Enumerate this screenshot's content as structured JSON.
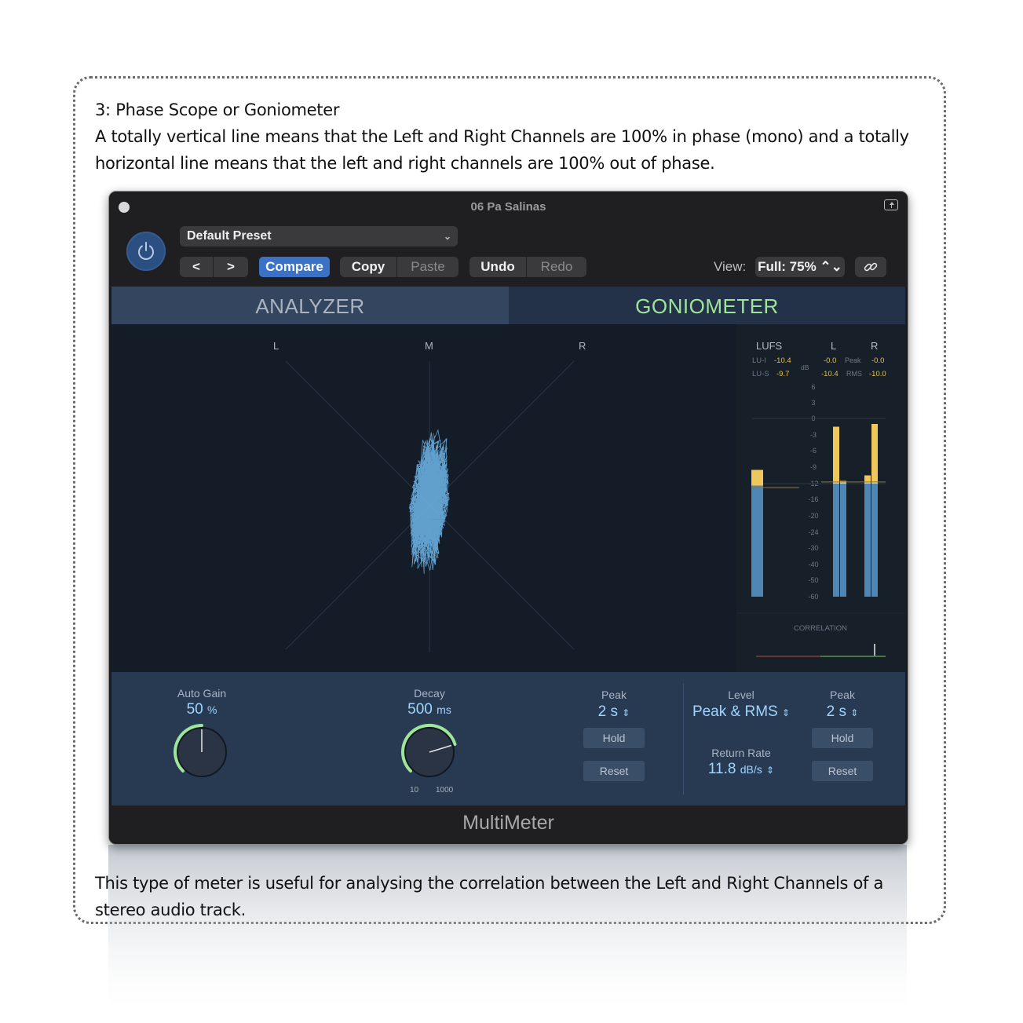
{
  "document": {
    "heading": "3: Phase Scope or Goniometer",
    "paragraph1": "A totally vertical line means that the Left and Right Channels are 100% in phase (mono) and a totally horizontal line means that the left and right channels are 100% out of phase.",
    "paragraph2": "This type of meter is useful for analysing the correlation between the Left and Right Channels of a stereo audio track."
  },
  "window": {
    "title": "06 Pa Salinas"
  },
  "toolbar": {
    "preset": "Default Preset",
    "prev": "<",
    "next": ">",
    "compare": "Compare",
    "copy": "Copy",
    "paste": "Paste",
    "undo": "Undo",
    "redo": "Redo",
    "view_label": "View:",
    "view_value": "Full: 75% ⌃⌄"
  },
  "tabs": {
    "analyzer": "ANALYZER",
    "goniometer": "GONIOMETER",
    "active": "GONIOMETER"
  },
  "scope": {
    "left": "L",
    "mid": "M",
    "right": "R"
  },
  "meters": {
    "lufs_label": "LUFS",
    "l_label": "L",
    "r_label": "R",
    "lu_i_label": "LU-I",
    "lu_i_value": "-10.4",
    "lu_s_label": "LU-S",
    "lu_s_value": "-9.7",
    "db_label": "dB",
    "peak_label": "Peak",
    "rms_label": "RMS",
    "l_peak": "-0.0",
    "r_peak": "-0.0",
    "l_rms": "-10.4",
    "r_rms": "-10.0",
    "scale": [
      "6",
      "3",
      "0",
      "-3",
      "-6",
      "-9",
      "-12",
      "-16",
      "-20",
      "-24",
      "-30",
      "-40",
      "-50",
      "-60"
    ],
    "correlation_label": "CORRELATION",
    "levels_db": {
      "lufs": {
        "rms": -12.5,
        "peak": -9.5
      },
      "l_a": {
        "rms": -12,
        "peak": -1.5
      },
      "l_b": {
        "rms": -12,
        "peak": -11.5
      },
      "r_a": {
        "rms": -12,
        "peak": -10.5
      },
      "r_b": {
        "rms": -12,
        "peak": -1.0
      }
    }
  },
  "controls": {
    "auto_gain_label": "Auto Gain",
    "auto_gain_value": "50",
    "auto_gain_unit": "%",
    "auto_gain_fraction": 0.5,
    "decay_label": "Decay",
    "decay_value": "500",
    "decay_unit": "ms",
    "decay_fraction": 0.77,
    "decay_min": "10",
    "decay_max": "1000",
    "peak_label": "Peak",
    "peak_value": "2 s",
    "hold": "Hold",
    "reset": "Reset",
    "level_label": "Level",
    "level_value": "Peak & RMS",
    "return_rate_label": "Return Rate",
    "return_rate_value": "11.8",
    "return_rate_unit": "dB/s",
    "peak2_label": "Peak",
    "peak2_value": "2 s",
    "hold2": "Hold",
    "reset2": "Reset"
  },
  "footer": {
    "title": "MultiMeter"
  },
  "colors": {
    "accent_green": "#9ee59a",
    "meter_blue": "#4f86b4",
    "meter_yellow": "#f0c75a",
    "compare_blue": "#3b72c6"
  }
}
